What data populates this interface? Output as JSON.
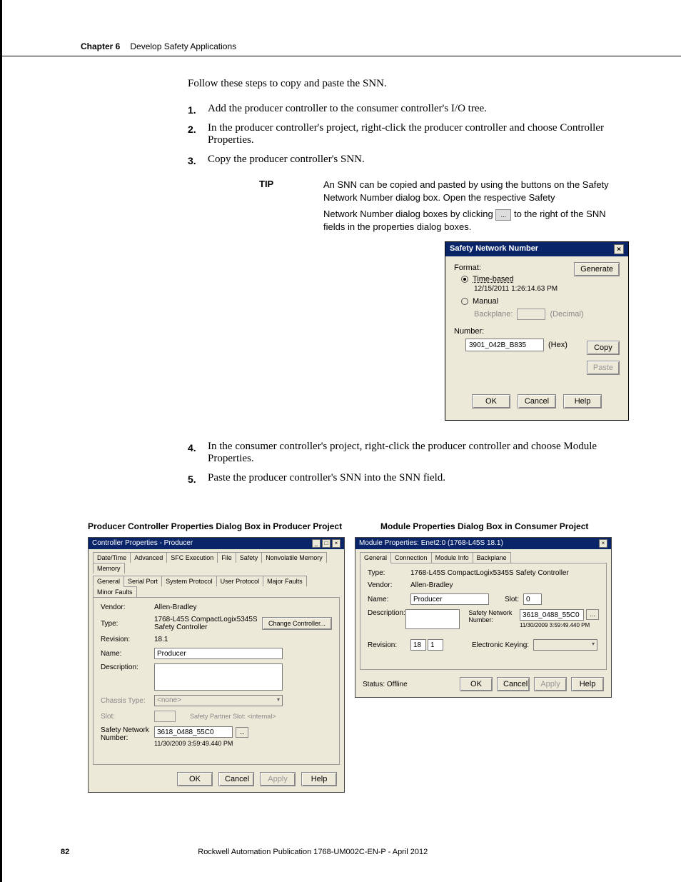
{
  "header": {
    "chapter": "Chapter 6",
    "title": "Develop Safety Applications"
  },
  "intro": "Follow these steps to copy and paste the SNN.",
  "steps": {
    "s1": "Add the producer controller to the consumer controller's I/O tree.",
    "s2": "In the producer controller's project, right-click the producer controller and choose Controller Properties.",
    "s3": "Copy the producer controller's SNN.",
    "s4": "In the consumer controller's project, right-click the producer controller and choose Module Properties.",
    "s5": "Paste the producer controller's SNN into the SNN field."
  },
  "tip": {
    "label": "TIP",
    "line1": "An SNN can be copied and pasted by using the buttons on the Safety Network Number dialog box. Open the respective Safety",
    "line2a": "Network Number dialog boxes by clicking",
    "line2b": "to the right of the SNN fields in the properties dialog boxes.",
    "iconLabel": "..."
  },
  "snn": {
    "title": "Safety Network Number",
    "format": "Format:",
    "timeBased": "Time-based",
    "timestamp": "12/15/2011 1:26:14.63 PM",
    "manual": "Manual",
    "backplane": "Backplane:",
    "decimal": "(Decimal)",
    "numberLbl": "Number:",
    "numberVal": "3901_042B_B835",
    "hex": "(Hex)",
    "generate": "Generate",
    "copy": "Copy",
    "paste": "Paste",
    "ok": "OK",
    "cancel": "Cancel",
    "help": "Help"
  },
  "captions": {
    "c1": "Producer Controller Properties Dialog Box in Producer Project",
    "c2": "Module Properties Dialog Box in Consumer Project"
  },
  "dlg1": {
    "title": "Controller Properties - Producer",
    "tabsTop": [
      "Date/Time",
      "Advanced",
      "SFC Execution",
      "File",
      "Safety",
      "Nonvolatile Memory",
      "Memory"
    ],
    "tabsBot": [
      "General",
      "Serial Port",
      "System Protocol",
      "User Protocol",
      "Major Faults",
      "Minor Faults"
    ],
    "vendorLbl": "Vendor:",
    "vendor": "Allen-Bradley",
    "typeLbl": "Type:",
    "type": "1768-L45S CompactLogix5345S Safety Controller",
    "changeCtrl": "Change Controller...",
    "revLbl": "Revision:",
    "rev": "18.1",
    "nameLbl": "Name:",
    "name": "Producer",
    "descLbl": "Description:",
    "chassisLbl": "Chassis Type:",
    "chassis": "<none>",
    "slotLbl": "Slot:",
    "slotNote": "Safety Partner Slot: <internal>",
    "snnLbl": "Safety Network Number:",
    "snn": "3618_0488_55C0",
    "snnTs": "11/30/2009 3:59:49.440 PM",
    "ok": "OK",
    "cancel": "Cancel",
    "apply": "Apply",
    "help": "Help"
  },
  "dlg2": {
    "title": "Module Properties: Enet2:0 (1768-L45S 18.1)",
    "tabs": [
      "General",
      "Connection",
      "Module Info",
      "Backplane"
    ],
    "typeLbl": "Type:",
    "type": "1768-L45S CompactLogix5345S Safety Controller",
    "vendorLbl": "Vendor:",
    "vendor": "Allen-Bradley",
    "nameLbl": "Name:",
    "name": "Producer",
    "slotLbl": "Slot:",
    "slot": "0",
    "descLbl": "Description:",
    "snnLbl": "Safety Network Number:",
    "snn": "3618_0488_55C0",
    "snnTs": "11/30/2009 3:59:49.440 PM",
    "revLbl": "Revision:",
    "revMaj": "18",
    "revMin": "1",
    "ekeyLbl": "Electronic Keying:",
    "status": "Status: Offline",
    "ok": "OK",
    "cancel": "Cancel",
    "apply": "Apply",
    "help": "Help"
  },
  "footer": {
    "page": "82",
    "pub": "Rockwell Automation Publication 1768-UM002C-EN-P - April 2012"
  }
}
